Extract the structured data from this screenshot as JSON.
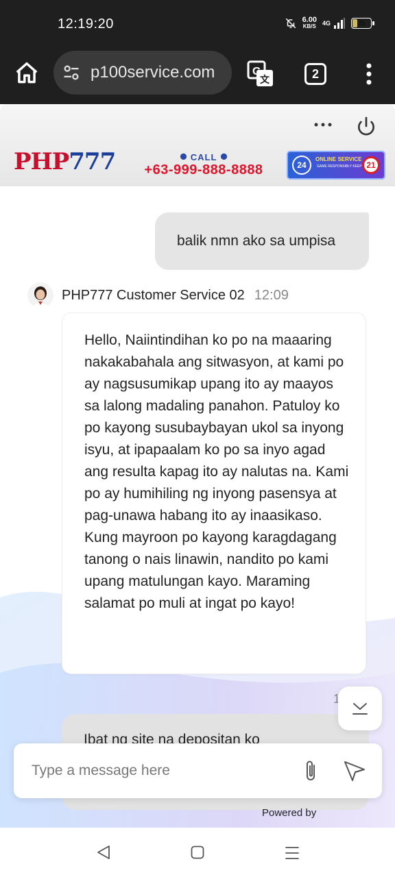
{
  "status_bar": {
    "time": "12:19:20",
    "net_speed_value": "6.00",
    "net_speed_unit": "KB/S",
    "network": "4G",
    "battery": "25"
  },
  "browser": {
    "url": "p100service.com",
    "tab_count": "2"
  },
  "chat_header": {
    "brand_php": "PHP",
    "brand_num": "777",
    "call_label": "CALL",
    "call_number": "+63-999-888-8888",
    "badge_hours": "24",
    "badge_title": "ONLINE SERVICE",
    "badge_subtitle": "GAME RESPONSIBLY KEEP IT FUN",
    "badge_age": "21"
  },
  "messages": {
    "user_message": "balik nmn ako sa umpisa",
    "agent_name": "PHP777 Customer Service 02",
    "agent_time": "12:09",
    "agent_message": "Hello, Naiintindihan ko po na maaaring nakakabahala ang sitwasyon, at kami po ay nagsusumikap upang ito ay maayos sa lalong madaling panahon. Patuloy ko po kayong susubaybayan ukol sa inyong isyu, at ipapaalam ko po sa inyo agad ang resulta kapag ito ay nalutas na. Kami po ay humihiling ng inyong pasensya at pag-unawa habang ito ay inaasikaso. Kung mayroon po kayong karagdagang tanong o nais linawin, nandito po kami upang matulungan kayo. Maraming salamat po muli at ingat po kayo!",
    "partial_time": "1",
    "partial_message": "Ibat ng site na depositan ko"
  },
  "composer": {
    "placeholder": "Type a message here",
    "powered_by": "Powered by"
  },
  "colors": {
    "brand_red": "#c8102e",
    "brand_blue": "#1d3f9b",
    "call_red": "#e0132a"
  }
}
